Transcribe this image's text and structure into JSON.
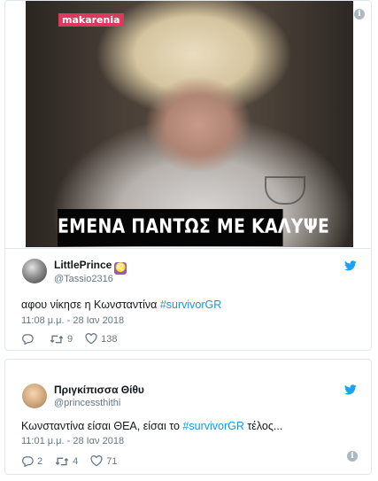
{
  "tweet1": {
    "media": {
      "logo": "makarenia",
      "caption": "ΕΜΕΝΑ ΠΑΝΤΩΣ ΜΕ ΚΑΛΥΨΕ"
    },
    "author": {
      "name": "LittlePrince",
      "badge": "♌",
      "handle": "@Tassio2316"
    },
    "text_before": "αφου νίκησε η Κωνσταντίνα ",
    "hashtag": "#survivorGR",
    "time": "11:08 μ.μ. - 28 Ιαν 2018",
    "retweets": "9",
    "likes": "138",
    "info_glyph": "i"
  },
  "tweet2": {
    "author": {
      "name": "Πριγκίπισσα Θίθυ",
      "handle": "@princessthithi"
    },
    "text_before": "Κωνσταντίνα είσαι ΘΕΑ, είσαι το ",
    "hashtag": "#survivorGR",
    "text_after": " τέλος...",
    "time": "11:01 μ.μ. - 28 Ιαν 2018",
    "replies": "2",
    "retweets": "4",
    "likes": "71",
    "info_glyph": "i"
  },
  "colors": {
    "twitter_blue": "#1da1f2",
    "link": "#1b95e0",
    "muted": "#657786",
    "logo_bg": "#d93a5d"
  },
  "icons": [
    "info-icon",
    "twitter-bird-icon",
    "reply-icon",
    "retweet-icon",
    "like-icon"
  ]
}
